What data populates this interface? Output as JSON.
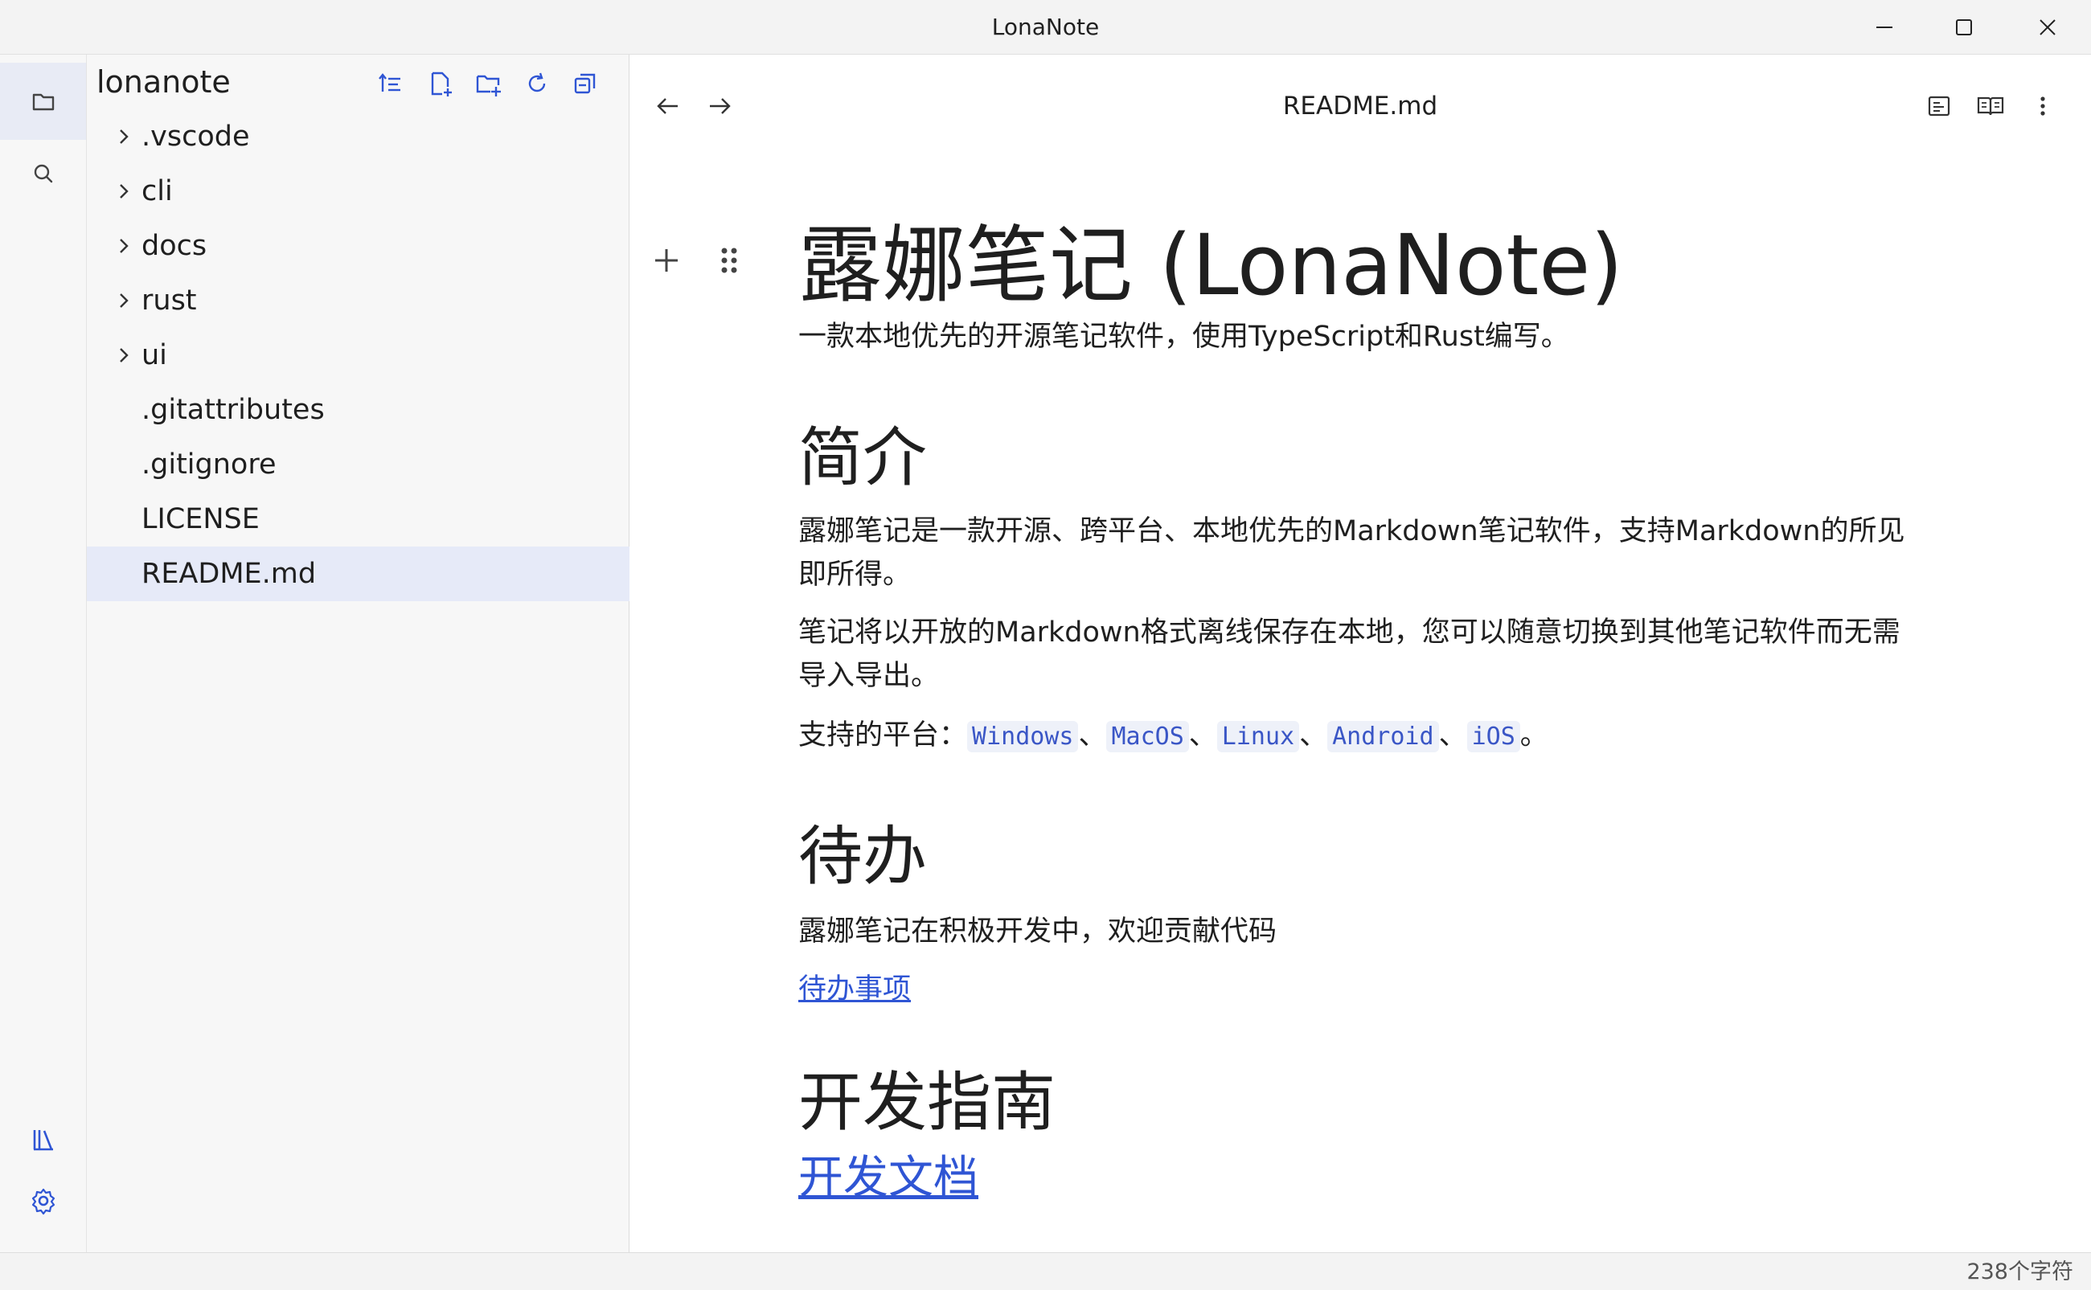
{
  "window": {
    "title": "LonaNote"
  },
  "activitybar": {
    "top": [
      {
        "name": "folder-icon",
        "active": true
      },
      {
        "name": "search-icon",
        "active": false
      }
    ],
    "bottom": [
      {
        "name": "library-icon"
      },
      {
        "name": "gear-icon"
      }
    ]
  },
  "explorer": {
    "root": "lonanote",
    "tools": [
      "sort-icon",
      "new-file-icon",
      "new-folder-icon",
      "refresh-icon",
      "collapse-all-icon"
    ],
    "items": [
      {
        "label": ".vscode",
        "type": "folder"
      },
      {
        "label": "cli",
        "type": "folder"
      },
      {
        "label": "docs",
        "type": "folder"
      },
      {
        "label": "rust",
        "type": "folder"
      },
      {
        "label": "ui",
        "type": "folder"
      },
      {
        "label": ".gitattributes",
        "type": "file"
      },
      {
        "label": ".gitignore",
        "type": "file"
      },
      {
        "label": "LICENSE",
        "type": "file"
      },
      {
        "label": "README.md",
        "type": "file",
        "selected": true
      }
    ]
  },
  "editor": {
    "doc_title": "README.md",
    "h1": "露娜笔记 (LonaNote)",
    "subtitle": "一款本地优先的开源笔记软件，使用TypeScript和Rust编写。",
    "section_intro": {
      "heading": "简介",
      "p1": "露娜笔记是一款开源、跨平台、本地优先的Markdown笔记软件，支持Markdown的所见即所得。",
      "p2": "笔记将以开放的Markdown格式离线保存在本地，您可以随意切换到其他笔记软件而无需导入导出。",
      "platforms_label": "支持的平台：",
      "platforms": [
        "Windows",
        "MacOS",
        "Linux",
        "Android",
        "iOS"
      ],
      "sep": "、",
      "end": "。"
    },
    "section_todo": {
      "heading": "待办",
      "p": "露娜笔记在积极开发中，欢迎贡献代码",
      "link": "待办事项"
    },
    "section_dev": {
      "heading": "开发指南",
      "link": "开发文档"
    }
  },
  "statusbar": {
    "char_count": "238个字符"
  },
  "colors": {
    "accent": "#2f55d4",
    "selected_bg": "#e6eaf8",
    "sidebar_bg": "#f7f7f7"
  }
}
